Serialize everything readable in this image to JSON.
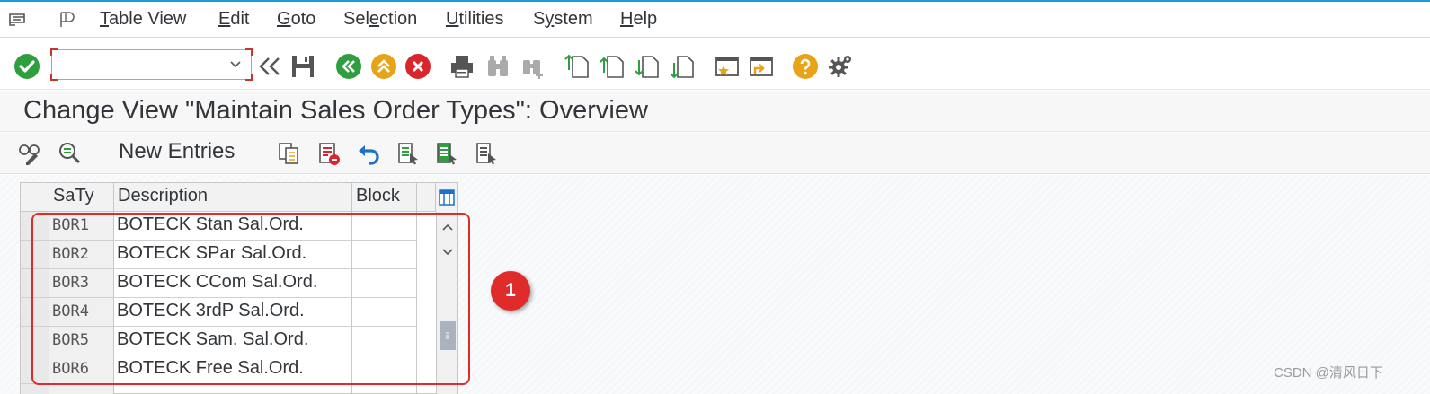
{
  "menu": {
    "items": [
      {
        "pre": "",
        "ul": "T",
        "post": "able View"
      },
      {
        "pre": "",
        "ul": "E",
        "post": "dit"
      },
      {
        "pre": "",
        "ul": "G",
        "post": "oto"
      },
      {
        "pre": "Sel",
        "ul": "e",
        "post": "ction"
      },
      {
        "pre": "",
        "ul": "U",
        "post": "tilities"
      },
      {
        "pre": "S",
        "ul": "y",
        "post": "stem"
      },
      {
        "pre": "",
        "ul": "H",
        "post": "elp"
      }
    ]
  },
  "toolbar": {
    "command_field_value": ""
  },
  "page": {
    "title": "Change View \"Maintain Sales Order Types\": Overview"
  },
  "app_toolbar": {
    "new_entries_label": "New Entries"
  },
  "table": {
    "columns": [
      "SaTy",
      "Description",
      "Block"
    ],
    "rows": [
      {
        "saty": "BOR1",
        "description": "BOTECK Stan Sal.Ord.",
        "block": ""
      },
      {
        "saty": "BOR2",
        "description": "BOTECK SPar Sal.Ord.",
        "block": ""
      },
      {
        "saty": "BOR3",
        "description": "BOTECK CCom Sal.Ord.",
        "block": ""
      },
      {
        "saty": "BOR4",
        "description": "BOTECK 3rdP Sal.Ord.",
        "block": ""
      },
      {
        "saty": "BOR5",
        "description": "BOTECK Sam. Sal.Ord.",
        "block": ""
      },
      {
        "saty": "BOR6",
        "description": "BOTECK Free Sal.Ord.",
        "block": ""
      }
    ]
  },
  "annotation": {
    "marker_number": "1",
    "color": "#e02b2b"
  },
  "watermark": "CSDN @清风日下",
  "colors": {
    "accent_blue": "#1a9ed6",
    "ok_green": "#2e9e3e",
    "nav_green": "#2e9e3e",
    "nav_yellow": "#e8a317",
    "cancel_red": "#d9262c",
    "help_orange": "#e8a317"
  }
}
